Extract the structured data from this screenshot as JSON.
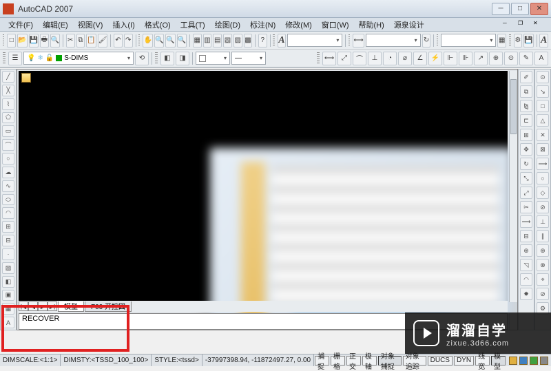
{
  "app": {
    "title": "AutoCAD 2007"
  },
  "menu": [
    "文件(F)",
    "编辑(E)",
    "视图(V)",
    "插入(I)",
    "格式(O)",
    "工具(T)",
    "绘图(D)",
    "标注(N)",
    "修改(M)",
    "窗口(W)",
    "帮助(H)",
    "源泉设计"
  ],
  "layer_row": {
    "layer": "S-DIMS",
    "color_style": ""
  },
  "style_combo": "A",
  "tabs": {
    "nav": [
      "|◀",
      "◀",
      "▶",
      "▶|"
    ],
    "items": [
      "模型",
      "F00 开控図"
    ]
  },
  "command": {
    "text": "RECOVER"
  },
  "status": {
    "dimscale": "DIMSCALE:<1:1>",
    "dimsty": "DIMSTY:<TSSD_100_100>",
    "style": "STYLE:<tssd>",
    "coords": "-37997398.94, -11872497.27, 0.00",
    "toggles": [
      "捕捉",
      "栅格",
      "正交",
      "极轴",
      "对象捕捉",
      "对象追踪",
      "DUCS",
      "DYN",
      "线宽",
      "模型"
    ]
  },
  "watermark": {
    "title": "溜溜自学",
    "url": "zixue.3d66.com"
  }
}
